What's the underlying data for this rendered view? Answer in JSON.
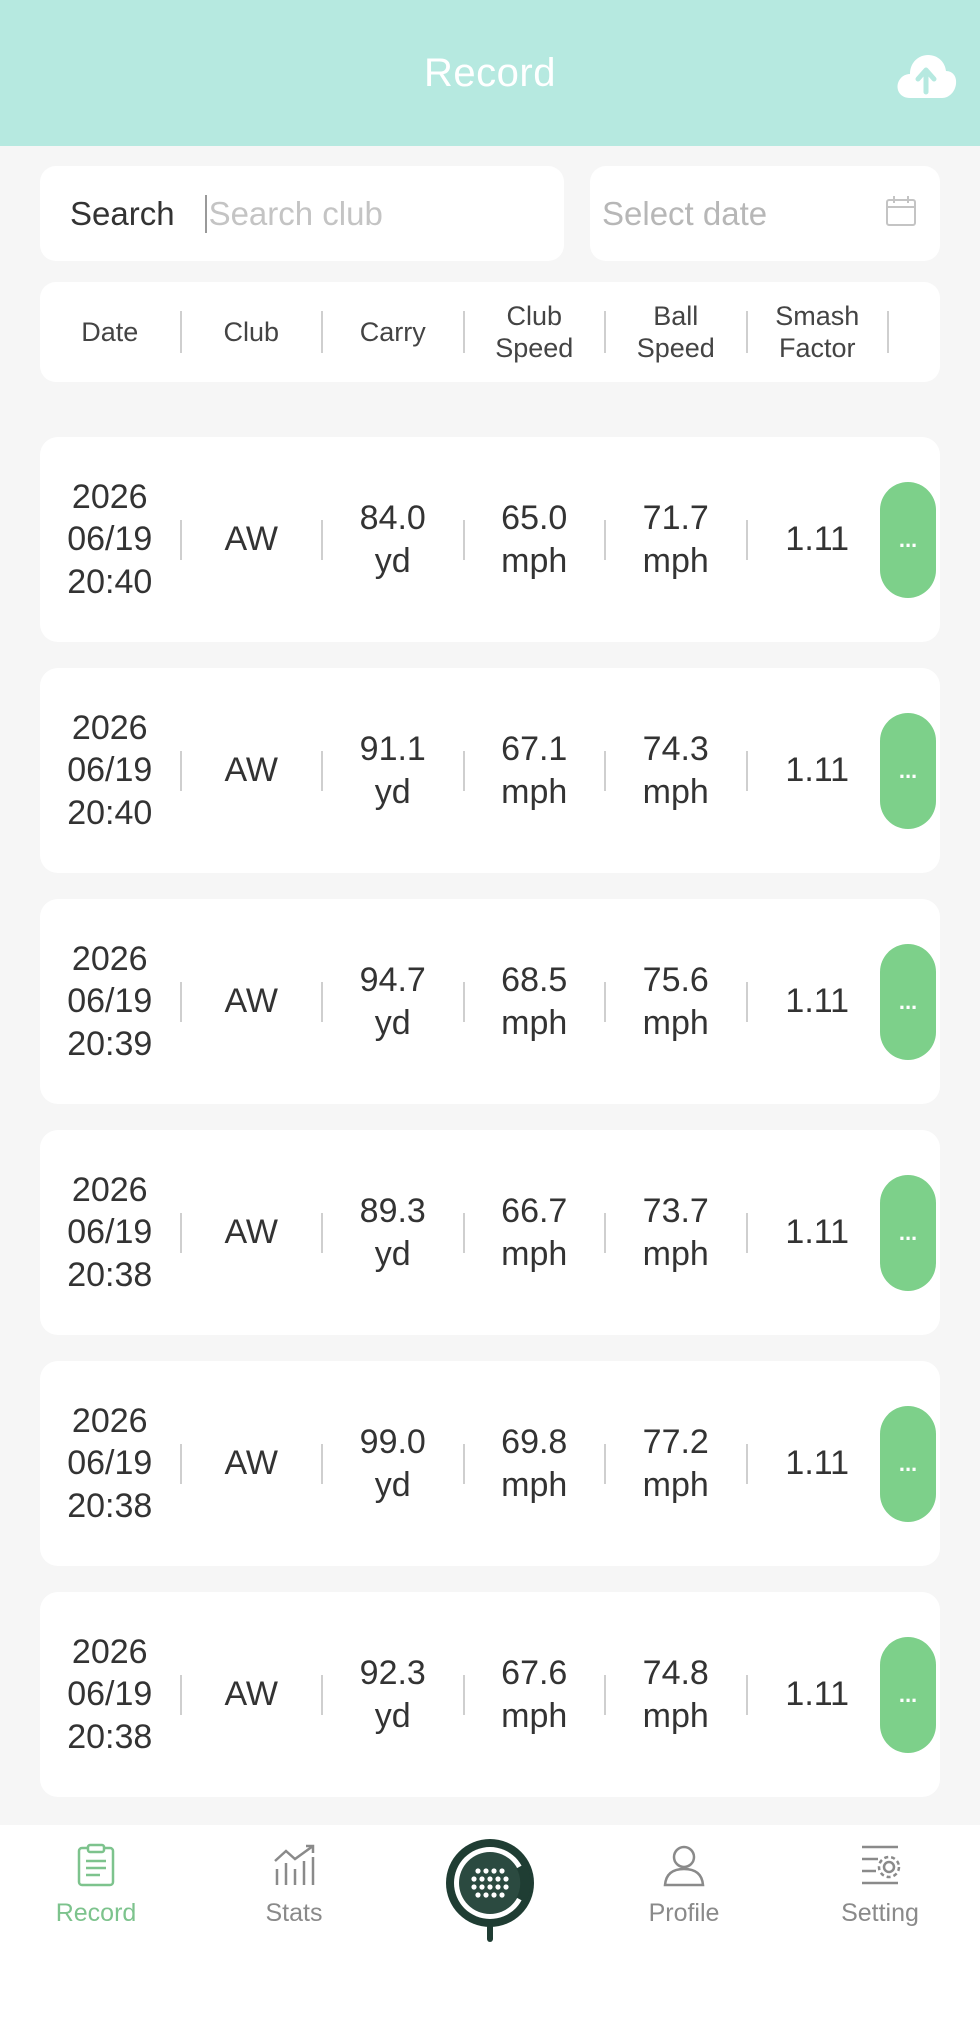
{
  "header": {
    "title": "Record",
    "upload_icon": "cloud-upload-icon"
  },
  "search": {
    "label": "Search",
    "placeholder": "Search club",
    "value": ""
  },
  "date_filter": {
    "placeholder": "Select date",
    "icon": "calendar-icon"
  },
  "columns": {
    "date": "Date",
    "club": "Club",
    "carry": "Carry",
    "club_speed_1": "Club",
    "club_speed_2": "Speed",
    "ball_speed_1": "Ball",
    "ball_speed_2": "Speed",
    "smash_1": "Smash",
    "smash_2": "Factor"
  },
  "records": [
    {
      "year": "2026",
      "date": "06/19",
      "time": "20:40",
      "club": "AW",
      "carry": "84.0",
      "carry_unit": "yd",
      "club_speed": "65.0",
      "club_speed_unit": "mph",
      "ball_speed": "71.7",
      "ball_speed_unit": "mph",
      "smash": "1.11",
      "more": "..."
    },
    {
      "year": "2026",
      "date": "06/19",
      "time": "20:40",
      "club": "AW",
      "carry": "91.1",
      "carry_unit": "yd",
      "club_speed": "67.1",
      "club_speed_unit": "mph",
      "ball_speed": "74.3",
      "ball_speed_unit": "mph",
      "smash": "1.11",
      "more": "..."
    },
    {
      "year": "2026",
      "date": "06/19",
      "time": "20:39",
      "club": "AW",
      "carry": "94.7",
      "carry_unit": "yd",
      "club_speed": "68.5",
      "club_speed_unit": "mph",
      "ball_speed": "75.6",
      "ball_speed_unit": "mph",
      "smash": "1.11",
      "more": "..."
    },
    {
      "year": "2026",
      "date": "06/19",
      "time": "20:38",
      "club": "AW",
      "carry": "89.3",
      "carry_unit": "yd",
      "club_speed": "66.7",
      "club_speed_unit": "mph",
      "ball_speed": "73.7",
      "ball_speed_unit": "mph",
      "smash": "1.11",
      "more": "..."
    },
    {
      "year": "2026",
      "date": "06/19",
      "time": "20:38",
      "club": "AW",
      "carry": "99.0",
      "carry_unit": "yd",
      "club_speed": "69.8",
      "club_speed_unit": "mph",
      "ball_speed": "77.2",
      "ball_speed_unit": "mph",
      "smash": "1.11",
      "more": "..."
    },
    {
      "year": "2026",
      "date": "06/19",
      "time": "20:38",
      "club": "AW",
      "carry": "92.3",
      "carry_unit": "yd",
      "club_speed": "67.6",
      "club_speed_unit": "mph",
      "ball_speed": "74.8",
      "ball_speed_unit": "mph",
      "smash": "1.11",
      "more": "..."
    }
  ],
  "tabbar": {
    "record": {
      "label": "Record",
      "icon": "clipboard-icon"
    },
    "stats": {
      "label": "Stats",
      "icon": "chart-icon"
    },
    "center": {
      "icon": "golf-ball-launch-icon"
    },
    "profile": {
      "label": "Profile",
      "icon": "user-icon"
    },
    "setting": {
      "label": "Setting",
      "icon": "settings-icon"
    }
  },
  "colors": {
    "header_bg": "#b6e9e0",
    "accent_green": "#7dd08a",
    "active_tab": "#7dc38d"
  }
}
